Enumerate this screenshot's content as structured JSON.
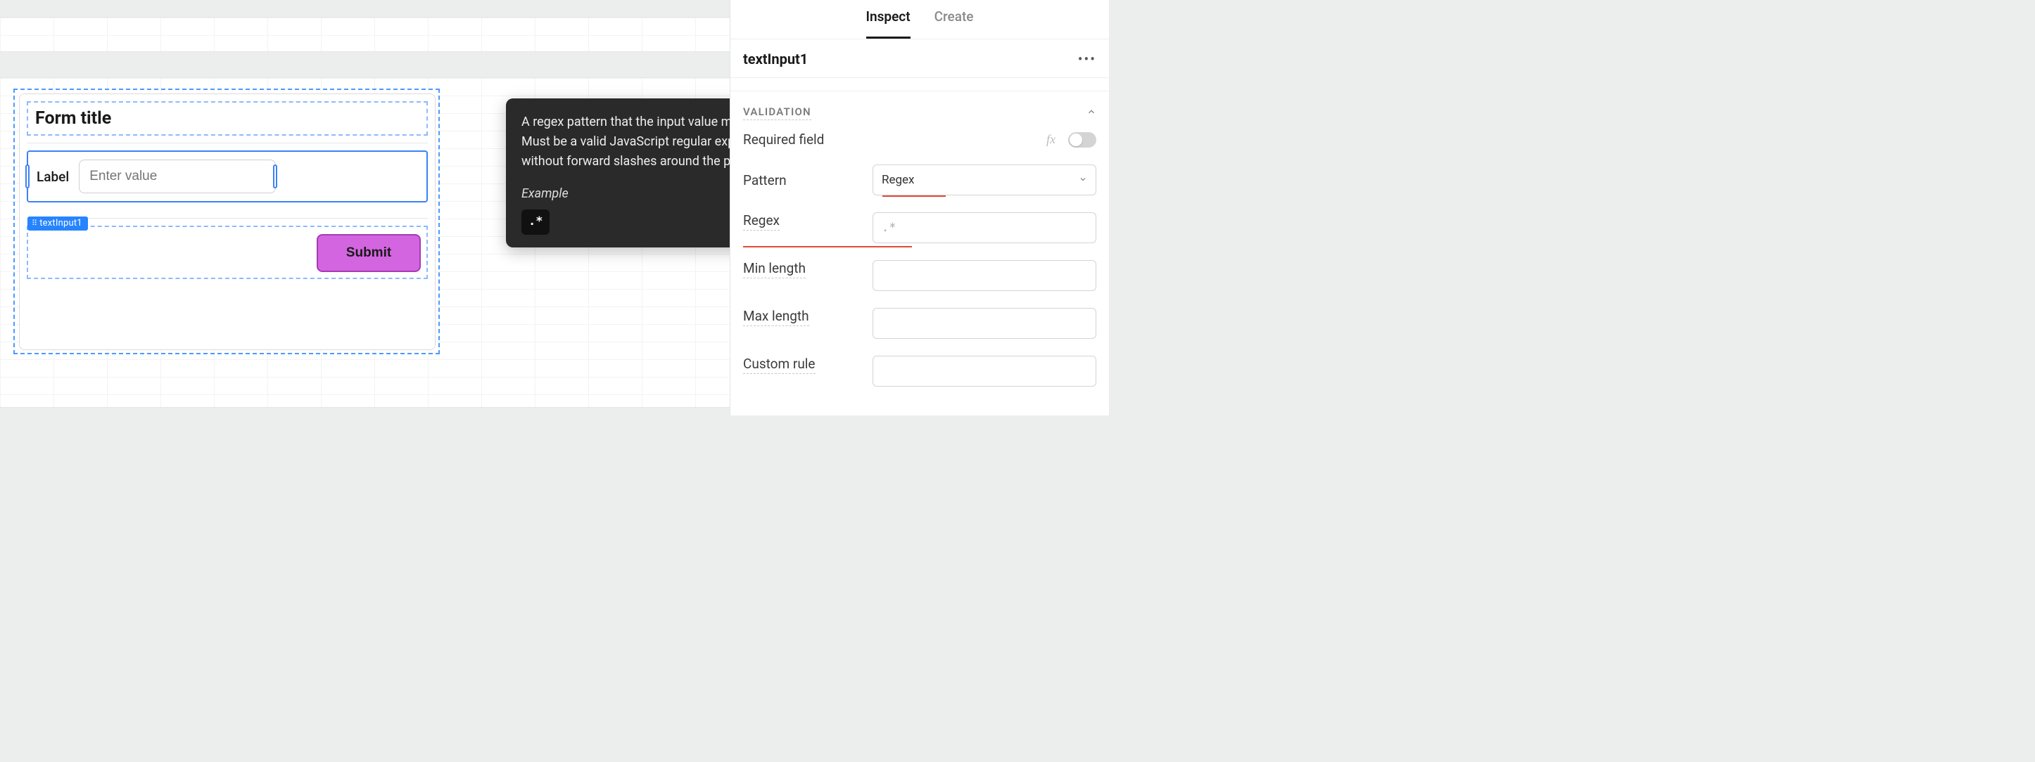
{
  "tabs": {
    "inspect": "Inspect",
    "create": "Create"
  },
  "panel": {
    "component_name": "textInput1",
    "section_title": "VALIDATION",
    "rows": {
      "required": "Required field",
      "pattern": "Pattern",
      "pattern_value": "Regex",
      "regex": "Regex",
      "regex_placeholder": ".*",
      "min_length": "Min length",
      "max_length": "Max length",
      "custom_rule": "Custom rule"
    },
    "fx": "fx"
  },
  "form": {
    "title": "Form title",
    "input_label": "Label",
    "input_placeholder": "Enter value",
    "component_tag": "textInput1",
    "submit": "Submit"
  },
  "tooltip": {
    "body": "A regex pattern that the input value must match. Must be a valid JavaScript regular expression without forward slashes around the pattern.",
    "example_label": "Example",
    "example_code": ".*"
  }
}
